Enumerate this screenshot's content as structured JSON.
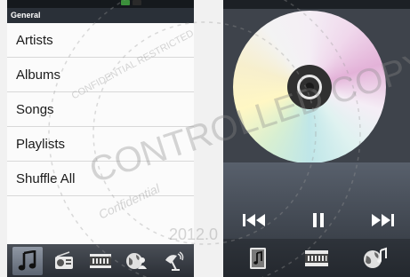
{
  "library": {
    "section_header": "General",
    "items": [
      {
        "label": "Artists"
      },
      {
        "label": "Albums"
      },
      {
        "label": "Songs"
      },
      {
        "label": "Playlists"
      },
      {
        "label": "Shuffle All"
      }
    ],
    "bottom_tabs": [
      {
        "icon": "music-note-icon",
        "active": true
      },
      {
        "icon": "radio-icon",
        "active": false
      },
      {
        "icon": "film-icon",
        "active": false
      },
      {
        "icon": "globe-people-icon",
        "active": false
      },
      {
        "icon": "satellite-dish-icon",
        "active": false
      }
    ]
  },
  "now_playing": {
    "album_art": "cd-disc-icon",
    "transport": [
      {
        "icon": "previous-icon"
      },
      {
        "icon": "pause-icon"
      },
      {
        "icon": "next-icon"
      }
    ],
    "bottom_tabs": [
      {
        "icon": "music-library-icon"
      },
      {
        "icon": "film-icon"
      },
      {
        "icon": "globe-note-icon"
      }
    ]
  },
  "watermark": {
    "line1": "CONTROLLED COPY",
    "line2": "Confidential",
    "line3": "2012.0",
    "restricted": "CONFIDENTIAL RESTRICTED"
  },
  "colors": {
    "header_bg": "#2a3038",
    "tab_bar_bg": "#3a3f47",
    "active_tab": "#7b8390",
    "player_bg": "#3b4049"
  }
}
